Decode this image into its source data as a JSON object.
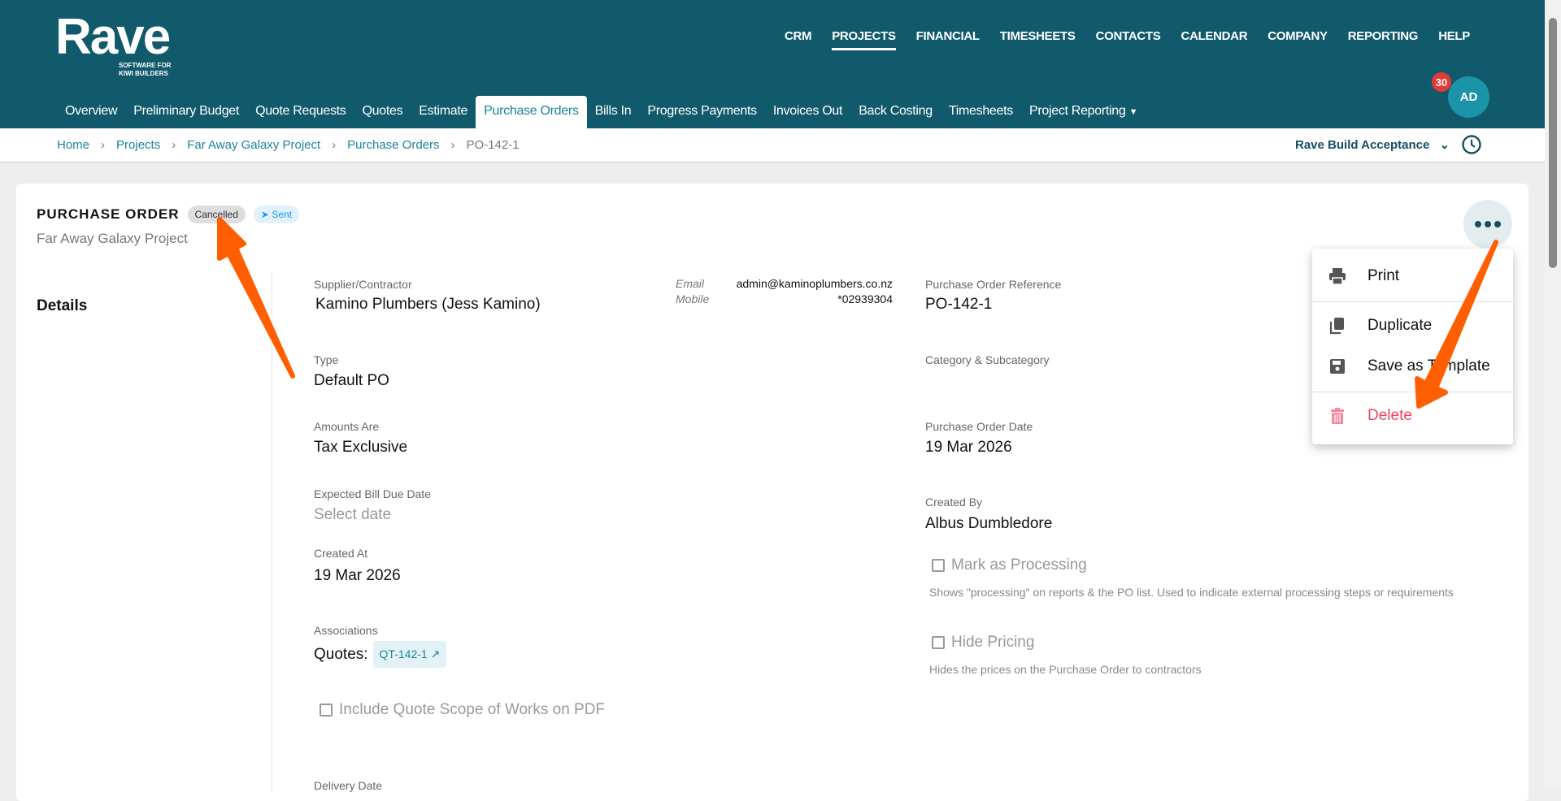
{
  "app": {
    "logo": "Rave",
    "logo_tagline_1": "SOFTWARE FOR",
    "logo_tagline_2": "KIWI BUILDERS"
  },
  "topnav": [
    "CRM",
    "PROJECTS",
    "FINANCIAL",
    "TIMESHEETS",
    "CONTACTS",
    "CALENDAR",
    "COMPANY",
    "REPORTING",
    "HELP"
  ],
  "subnav": [
    "Overview",
    "Preliminary Budget",
    "Quote Requests",
    "Quotes",
    "Estimate",
    "Purchase Orders",
    "Bills In",
    "Progress Payments",
    "Invoices Out",
    "Back Costing",
    "Timesheets",
    "Project Reporting"
  ],
  "user": {
    "initials": "AD",
    "notifications": "30"
  },
  "breadcrumb": [
    "Home",
    "Projects",
    "Far Away Galaxy Project",
    "Purchase Orders",
    "PO-142-1"
  ],
  "org_selector": "Rave Build Acceptance",
  "po": {
    "title": "PURCHASE ORDER",
    "status": "Cancelled",
    "sent": "Sent",
    "project": "Far Away Galaxy Project",
    "section": "Details",
    "supplier_label": "Supplier/Contractor",
    "supplier": "Kamino Plumbers (Jess Kamino)",
    "email_label": "Email",
    "email": "admin@kaminoplumbers.co.nz",
    "mobile_label": "Mobile",
    "mobile": "*02939304",
    "type_label": "Type",
    "type": "Default PO",
    "amounts_label": "Amounts Are",
    "amounts": "Tax Exclusive",
    "due_label": "Expected Bill Due Date",
    "due_placeholder": "Select date",
    "created_at_label": "Created At",
    "created_at": "19 Mar 2026",
    "assoc_label": "Associations",
    "quotes_label": "Quotes:",
    "quote": "QT-142-1",
    "include_scope": "Include Quote Scope of Works on PDF",
    "delivery_label": "Delivery Date",
    "ref_label": "Purchase Order Reference",
    "ref": "PO-142-1",
    "category_label": "Category & Subcategory",
    "date_label": "Purchase Order Date",
    "date": "19 Mar 2026",
    "created_by_label": "Created By",
    "created_by": "Albus Dumbledore",
    "processing": "Mark as Processing",
    "processing_desc": "Shows \"processing\" on reports & the PO list. Used to indicate external processing steps or requirements",
    "hide_pricing": "Hide Pricing",
    "hide_pricing_desc": "Hides the prices on the Purchase Order to contractors"
  },
  "menu": {
    "print": "Print",
    "duplicate": "Duplicate",
    "save_template": "Save as Template",
    "delete": "Delete"
  },
  "colors": {
    "header": "#115a6c",
    "accent": "#1a8497",
    "delete": "#f0435f",
    "annotation": "#ff5f00"
  }
}
